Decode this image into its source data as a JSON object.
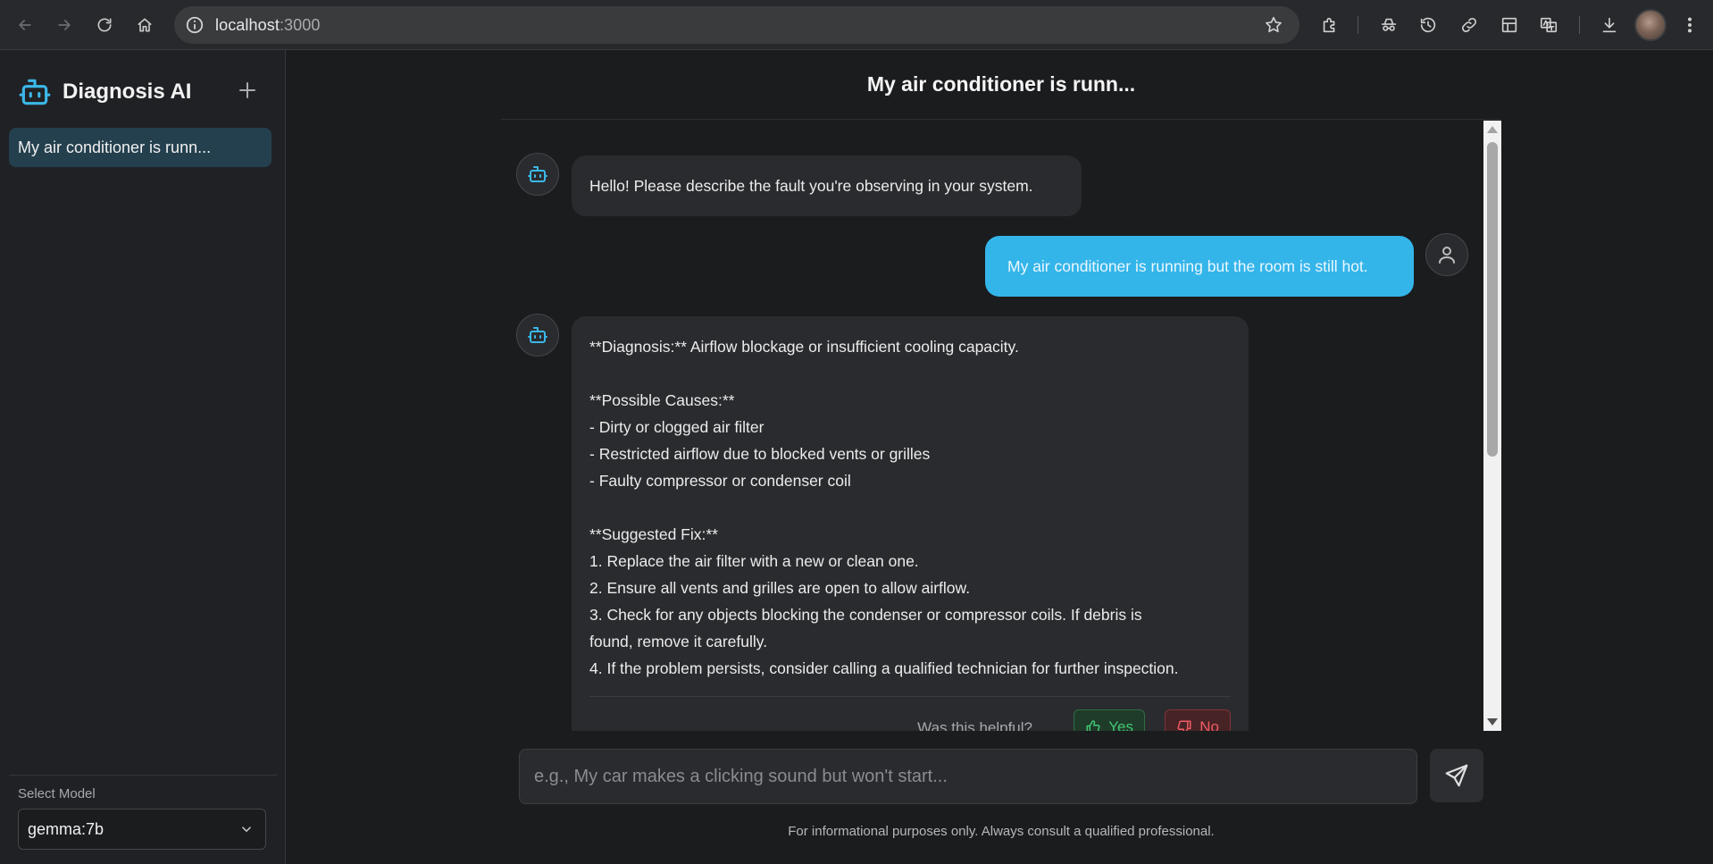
{
  "browser": {
    "url_host": "localhost",
    "url_port": ":3000"
  },
  "sidebar": {
    "app_title": "Diagnosis AI",
    "history": [
      {
        "label": "My air conditioner is runn..."
      }
    ],
    "model_label": "Select Model",
    "model_value": "gemma:7b"
  },
  "chat": {
    "title": "My air conditioner is runn...",
    "messages": [
      {
        "role": "assistant",
        "text": "Hello! Please describe the fault you're observing in your system."
      },
      {
        "role": "user",
        "text": "My air conditioner is running but the room is still hot."
      },
      {
        "role": "assistant",
        "lines": [
          "**Diagnosis:** Airflow blockage or insufficient cooling capacity.",
          "",
          "**Possible Causes:**",
          "- Dirty or clogged air filter",
          "- Restricted airflow due to blocked vents or grilles",
          "- Faulty compressor or condenser coil",
          "",
          "**Suggested Fix:**",
          "1. Replace the air filter with a new or clean one.",
          "2. Ensure all vents and grilles are open to allow airflow.",
          "3. Check for any objects blocking the condenser or compressor coils. If debris is",
          "found, remove it carefully.",
          "4. If the problem persists, consider calling a qualified technician for further inspection."
        ]
      }
    ],
    "feedback": {
      "question": "Was this helpful?",
      "yes_label": "Yes",
      "no_label": "No"
    }
  },
  "composer": {
    "placeholder": "e.g., My car makes a clicking sound but won't start...",
    "disclaimer": "For informational purposes only. Always consult a qualified professional."
  },
  "colors": {
    "accent": "#34b5ea",
    "bot_icon": "#3bb8e8",
    "yes_green": "#42c774",
    "no_red": "#ef5d63"
  }
}
